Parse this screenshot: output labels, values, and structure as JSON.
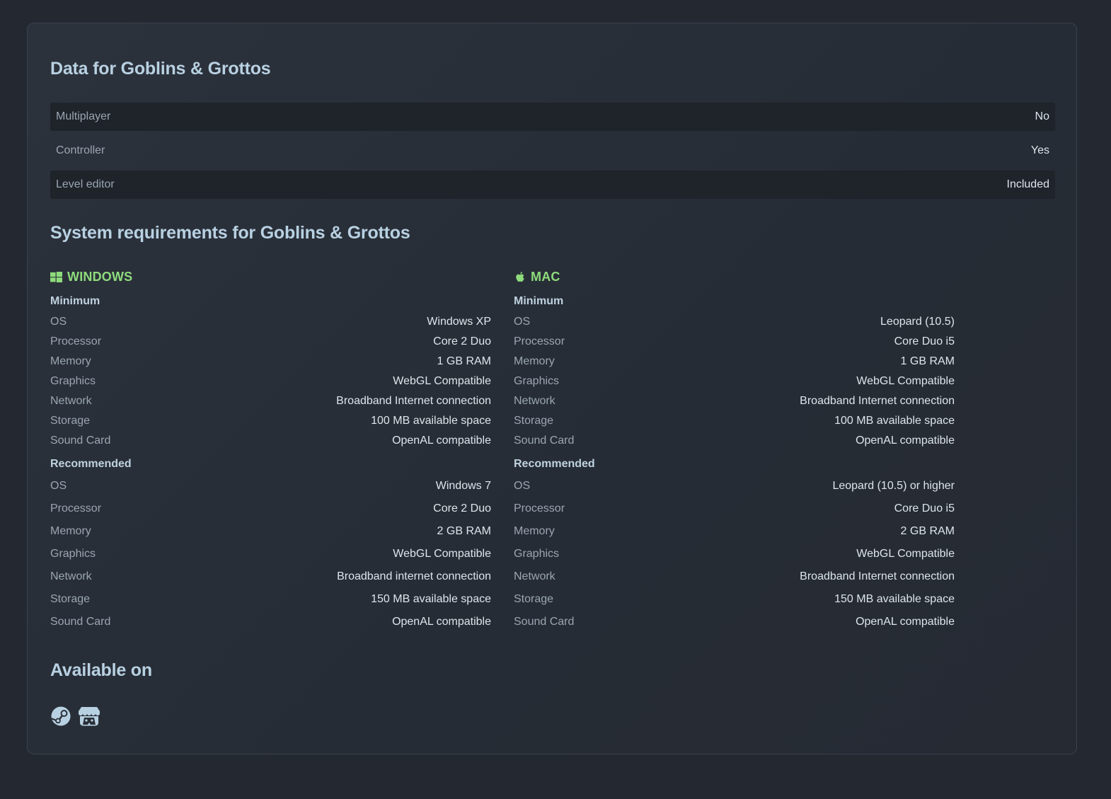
{
  "data_title": "Data for Goblins & Grottos",
  "features": [
    {
      "label": "Multiplayer",
      "value": "No"
    },
    {
      "label": "Controller",
      "value": "Yes"
    },
    {
      "label": "Level editor",
      "value": "Included"
    }
  ],
  "sysreq_title": "System requirements for Goblins & Grottos",
  "windows": {
    "name": "WINDOWS",
    "icon": "windows-icon",
    "minimum_label": "Minimum",
    "minimum": [
      {
        "label": "OS",
        "value": "Windows XP"
      },
      {
        "label": "Processor",
        "value": "Core 2 Duo"
      },
      {
        "label": "Memory",
        "value": "1 GB RAM"
      },
      {
        "label": "Graphics",
        "value": "WebGL Compatible"
      },
      {
        "label": "Network",
        "value": "Broadband Internet connection"
      },
      {
        "label": "Storage",
        "value": "100 MB available space"
      },
      {
        "label": "Sound Card",
        "value": "OpenAL compatible"
      }
    ],
    "recommended_label": "Recommended",
    "recommended": [
      {
        "label": "OS",
        "value": "Windows 7"
      },
      {
        "label": "Processor",
        "value": "Core 2 Duo"
      },
      {
        "label": "Memory",
        "value": "2 GB RAM"
      },
      {
        "label": "Graphics",
        "value": "WebGL Compatible"
      },
      {
        "label": "Network",
        "value": "Broadband internet connection"
      },
      {
        "label": "Storage",
        "value": "150 MB available space"
      },
      {
        "label": "Sound Card",
        "value": "OpenAL compatible"
      }
    ]
  },
  "mac": {
    "name": "MAC",
    "icon": "apple-icon",
    "minimum_label": "Minimum",
    "minimum": [
      {
        "label": "OS",
        "value": "Leopard (10.5)"
      },
      {
        "label": "Processor",
        "value": "Core Duo i5"
      },
      {
        "label": "Memory",
        "value": "1 GB RAM"
      },
      {
        "label": "Graphics",
        "value": "WebGL Compatible"
      },
      {
        "label": "Network",
        "value": "Broadband Internet connection"
      },
      {
        "label": "Storage",
        "value": "100 MB available space"
      },
      {
        "label": "Sound Card",
        "value": "OpenAL compatible"
      }
    ],
    "recommended_label": "Recommended",
    "recommended": [
      {
        "label": "OS",
        "value": "Leopard (10.5) or higher"
      },
      {
        "label": "Processor",
        "value": "Core Duo i5"
      },
      {
        "label": "Memory",
        "value": "2 GB RAM"
      },
      {
        "label": "Graphics",
        "value": "WebGL Compatible"
      },
      {
        "label": "Network",
        "value": "Broadband Internet connection"
      },
      {
        "label": "Storage",
        "value": "150 MB available space"
      },
      {
        "label": "Sound Card",
        "value": "OpenAL compatible"
      }
    ]
  },
  "available_title": "Available on",
  "stores": [
    {
      "icon": "steam-icon"
    },
    {
      "icon": "itch-io-icon"
    }
  ],
  "colors": {
    "background": "#232831",
    "accent_green": "#8edb7c",
    "heading": "#b8d1e2",
    "row_shade": "#1f232a"
  }
}
